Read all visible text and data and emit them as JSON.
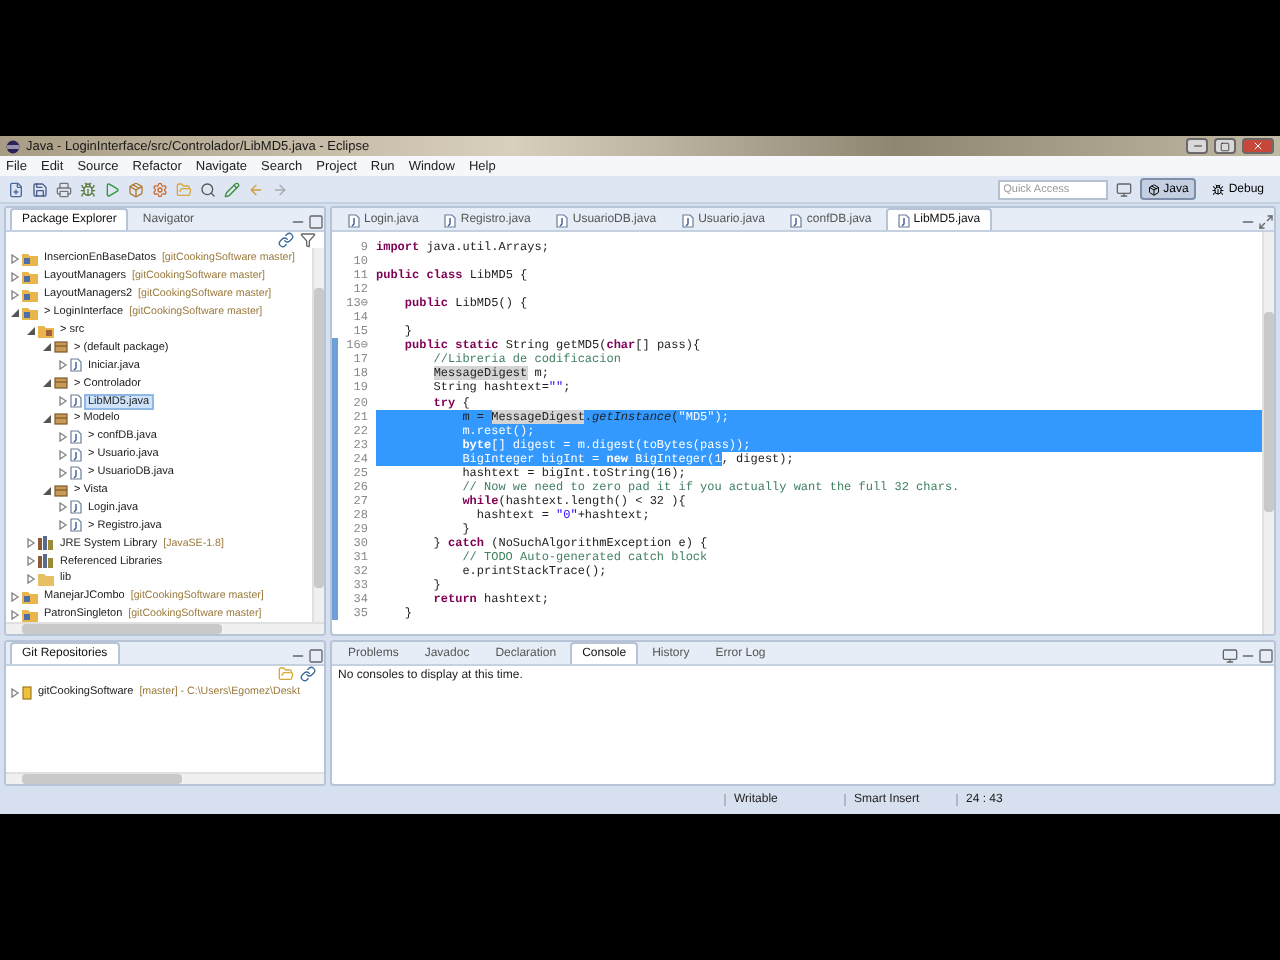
{
  "window": {
    "title": "Java - LoginInterface/src/Controlador/LibMD5.java - Eclipse"
  },
  "menu": [
    "File",
    "Edit",
    "Source",
    "Refactor",
    "Navigate",
    "Search",
    "Project",
    "Run",
    "Window",
    "Help"
  ],
  "quick_access": {
    "placeholder": "Quick Access"
  },
  "perspectives": [
    {
      "label": "Java",
      "selected": true
    },
    {
      "label": "Debug",
      "selected": false
    }
  ],
  "left_tabs": [
    {
      "label": "Package Explorer",
      "selected": true
    },
    {
      "label": "Navigator",
      "selected": false
    }
  ],
  "tree": [
    {
      "kind": "project",
      "label": "InsercionEnBaseDatos",
      "decoration": "[gitCookingSoftware master]",
      "expanded": false,
      "selected": false
    },
    {
      "kind": "project",
      "label": "LayoutManagers",
      "decoration": "[gitCookingSoftware master]",
      "expanded": false,
      "selected": false
    },
    {
      "kind": "project",
      "label": "LayoutManagers2",
      "decoration": "[gitCookingSoftware master]",
      "expanded": false,
      "selected": false
    },
    {
      "kind": "project",
      "label": "> LoginInterface",
      "decoration": "[gitCookingSoftware master]",
      "expanded": true,
      "selected": false,
      "children": [
        {
          "kind": "source",
          "label": "> src",
          "expanded": true,
          "selected": false,
          "children": [
            {
              "kind": "package",
              "label": "> (default package)",
              "expanded": true,
              "selected": false,
              "children": [
                {
                  "kind": "java",
                  "label": "Iniciar.java",
                  "expanded": false,
                  "selected": false
                }
              ]
            },
            {
              "kind": "package",
              "label": "> Controlador",
              "expanded": true,
              "selected": false,
              "children": [
                {
                  "kind": "java",
                  "label": "LibMD5.java",
                  "expanded": false,
                  "selected": true
                }
              ]
            },
            {
              "kind": "package",
              "label": "> Modelo",
              "expanded": true,
              "selected": false,
              "children": [
                {
                  "kind": "java",
                  "label": "> confDB.java",
                  "expanded": false,
                  "selected": false
                },
                {
                  "kind": "java",
                  "label": "> Usuario.java",
                  "expanded": false,
                  "selected": false
                },
                {
                  "kind": "java",
                  "label": "> UsuarioDB.java",
                  "expanded": false,
                  "selected": false
                }
              ]
            },
            {
              "kind": "package",
              "label": "> Vista",
              "expanded": true,
              "selected": false,
              "children": [
                {
                  "kind": "java",
                  "label": "Login.java",
                  "expanded": false,
                  "selected": false
                },
                {
                  "kind": "java",
                  "label": "> Registro.java",
                  "expanded": false,
                  "selected": false
                }
              ]
            }
          ]
        },
        {
          "kind": "library",
          "label": "JRE System Library",
          "decoration": "[JavaSE-1.8]",
          "expanded": false,
          "selected": false
        },
        {
          "kind": "library",
          "label": "Referenced Libraries",
          "expanded": false,
          "selected": false
        },
        {
          "kind": "folder",
          "label": "lib",
          "expanded": false,
          "selected": false
        }
      ]
    },
    {
      "kind": "project",
      "label": "ManejarJCombo",
      "decoration": "[gitCookingSoftware master]",
      "expanded": false,
      "selected": false
    },
    {
      "kind": "project",
      "label": "PatronSingleton",
      "decoration": "[gitCookingSoftware master]",
      "expanded": false,
      "selected": false
    }
  ],
  "editor_tabs": [
    {
      "label": "Login.java",
      "selected": false
    },
    {
      "label": "Registro.java",
      "selected": false
    },
    {
      "label": "UsuarioDB.java",
      "selected": false
    },
    {
      "label": "Usuario.java",
      "selected": false
    },
    {
      "label": "confDB.java",
      "selected": false
    },
    {
      "label": "LibMD5.java",
      "selected": true
    }
  ],
  "code": [
    {
      "num": "9",
      "in_range": false,
      "eol_selected": false,
      "parts": [
        {
          "kind": "keyword",
          "text": "import",
          "selected": false
        },
        {
          "kind": "plain",
          "text": " java.util.Arrays;",
          "selected": false
        }
      ]
    },
    {
      "num": "10",
      "in_range": false,
      "eol_selected": false
    },
    {
      "num": "11",
      "in_range": false,
      "eol_selected": false,
      "parts": [
        {
          "kind": "keyword",
          "text": "public class",
          "selected": false
        },
        {
          "kind": "plain",
          "text": " LibMD5 {",
          "selected": false
        }
      ]
    },
    {
      "num": "12",
      "in_range": false,
      "eol_selected": false
    },
    {
      "num": "13⊖",
      "in_range": false,
      "eol_selected": false,
      "parts": [
        {
          "kind": "keyword",
          "text": "    public",
          "selected": false
        },
        {
          "kind": "plain",
          "text": " LibMD5() {",
          "selected": false
        }
      ]
    },
    {
      "num": "14",
      "in_range": false,
      "eol_selected": false
    },
    {
      "num": "15",
      "in_range": false,
      "eol_selected": false,
      "parts": [
        {
          "kind": "plain",
          "text": "    }",
          "selected": false
        }
      ]
    },
    {
      "num": "16⊖",
      "in_range": true,
      "eol_selected": false,
      "parts": [
        {
          "kind": "keyword",
          "text": "    public static",
          "selected": false
        },
        {
          "kind": "plain",
          "text": " String getMD5(",
          "selected": false
        },
        {
          "kind": "keyword",
          "text": "char",
          "selected": false
        },
        {
          "kind": "plain",
          "text": "[] pass){",
          "selected": false
        }
      ]
    },
    {
      "num": "17",
      "in_range": true,
      "eol_selected": false,
      "parts": [
        {
          "kind": "comment",
          "text": "        //Libreria de codificacion",
          "selected": false
        }
      ]
    },
    {
      "num": "18",
      "in_range": true,
      "eol_selected": false,
      "parts": [
        {
          "kind": "occurrence",
          "text": "        MessageDigest",
          "selected": false
        },
        {
          "kind": "plain",
          "text": " m;",
          "selected": false
        }
      ]
    },
    {
      "num": "19",
      "in_range": true,
      "eol_selected": false,
      "parts": [
        {
          "kind": "plain",
          "text": "        String hashtext=",
          "selected": false
        },
        {
          "kind": "string",
          "text": "\"\"",
          "selected": false
        },
        {
          "kind": "plain",
          "text": ";",
          "selected": false
        }
      ]
    },
    {
      "num": "20",
      "in_range": true,
      "eol_selected": false,
      "parts": [
        {
          "kind": "keyword",
          "text": "        try",
          "selected": false
        },
        {
          "kind": "plain",
          "text": " {",
          "selected": false
        }
      ]
    },
    {
      "num": "21",
      "in_range": true,
      "eol_selected": true,
      "parts": [
        {
          "kind": "plain",
          "text": "            m = ",
          "selected": false
        },
        {
          "kind": "occurrence",
          "text": "MessageDigest",
          "selected": false
        },
        {
          "kind": "plain",
          "text": ".",
          "selected": false
        },
        {
          "kind": "static",
          "text": "getInstance",
          "selected": false
        },
        {
          "kind": "plain",
          "text": "(",
          "selected": false
        },
        {
          "kind": "string",
          "text": "\"MD5\"",
          "selected": true
        },
        {
          "kind": "plain",
          "text": ");",
          "selected": true
        }
      ]
    },
    {
      "num": "22",
      "in_range": true,
      "eol_selected": true,
      "parts": [
        {
          "kind": "plain",
          "text": "            m.reset();",
          "selected": true
        }
      ]
    },
    {
      "num": "23",
      "in_range": true,
      "eol_selected": true,
      "parts": [
        {
          "kind": "keyword",
          "text": "            byte",
          "selected": true
        },
        {
          "kind": "plain",
          "text": "[] digest = m.digest(toBytes(pass));",
          "selected": true
        }
      ]
    },
    {
      "num": "24",
      "in_range": true,
      "eol_selected": false,
      "parts": [
        {
          "kind": "plain",
          "text": "            BigInteger bigInt = ",
          "selected": true
        },
        {
          "kind": "keyword",
          "text": "new",
          "selected": true
        },
        {
          "kind": "plain",
          "text": " BigInteger(1",
          "selected": true
        },
        {
          "kind": "plain",
          "text": ", digest);",
          "selected": false
        }
      ]
    },
    {
      "num": "25",
      "in_range": true,
      "eol_selected": false,
      "parts": [
        {
          "kind": "plain",
          "text": "            hashtext = bigInt.toString(16);",
          "selected": false
        }
      ]
    },
    {
      "num": "26",
      "in_range": true,
      "eol_selected": false,
      "parts": [
        {
          "kind": "comment",
          "text": "            // Now we need to zero pad it if you actually want the full 32 chars.",
          "selected": false
        }
      ]
    },
    {
      "num": "27",
      "in_range": true,
      "eol_selected": false,
      "parts": [
        {
          "kind": "keyword",
          "text": "            while",
          "selected": false
        },
        {
          "kind": "plain",
          "text": "(hashtext.length() < 32 ){",
          "selected": false
        }
      ]
    },
    {
      "num": "28",
      "in_range": true,
      "eol_selected": false,
      "parts": [
        {
          "kind": "plain",
          "text": "              hashtext = ",
          "selected": false
        },
        {
          "kind": "string",
          "text": "\"0\"",
          "selected": false
        },
        {
          "kind": "plain",
          "text": "+hashtext;",
          "selected": false
        }
      ]
    },
    {
      "num": "29",
      "in_range": true,
      "eol_selected": false,
      "parts": [
        {
          "kind": "plain",
          "text": "            }",
          "selected": false
        }
      ]
    },
    {
      "num": "30",
      "in_range": true,
      "eol_selected": false,
      "parts": [
        {
          "kind": "plain",
          "text": "        } ",
          "selected": false
        },
        {
          "kind": "keyword",
          "text": "catch",
          "selected": false
        },
        {
          "kind": "plain",
          "text": " (NoSuchAlgorithmException e) {",
          "selected": false
        }
      ]
    },
    {
      "num": "31",
      "in_range": true,
      "eol_selected": false,
      "parts": [
        {
          "kind": "comment",
          "text": "            // TODO Auto-generated catch block",
          "selected": false
        }
      ]
    },
    {
      "num": "32",
      "in_range": true,
      "eol_selected": false,
      "parts": [
        {
          "kind": "plain",
          "text": "            e.printStackTrace();",
          "selected": false
        }
      ]
    },
    {
      "num": "33",
      "in_range": true,
      "eol_selected": false,
      "parts": [
        {
          "kind": "plain",
          "text": "        }",
          "selected": false
        }
      ]
    },
    {
      "num": "34",
      "in_range": true,
      "eol_selected": false,
      "parts": [
        {
          "kind": "keyword",
          "text": "        return",
          "selected": false
        },
        {
          "kind": "plain",
          "text": " hashtext;",
          "selected": false
        }
      ]
    },
    {
      "num": "35",
      "in_range": true,
      "eol_selected": false,
      "parts": [
        {
          "kind": "plain",
          "text": "    }",
          "selected": false
        }
      ]
    }
  ],
  "git_panel": {
    "tab": "Git Repositories",
    "repo": "gitCookingSoftware",
    "branch": "[master] - C:\\Users\\Egomez\\Deskt"
  },
  "bottom_tabs": [
    {
      "label": "Problems",
      "selected": false
    },
    {
      "label": "Javadoc",
      "selected": false
    },
    {
      "label": "Declaration",
      "selected": false
    },
    {
      "label": "Console",
      "selected": true
    },
    {
      "label": "History",
      "selected": false
    },
    {
      "label": "Error Log",
      "selected": false
    }
  ],
  "console_message": "No consoles to display at this time.",
  "status_bar": [
    "Writable",
    "Smart Insert",
    "24 : 43"
  ]
}
